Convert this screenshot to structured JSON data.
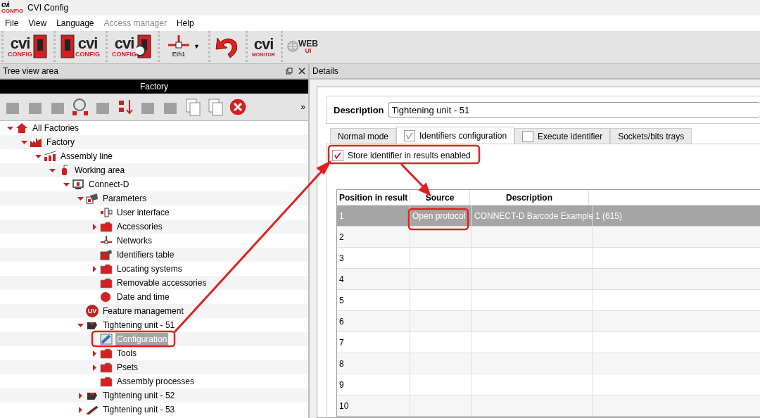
{
  "window": {
    "title": "CVI Config",
    "logo": "cvi",
    "logo_sub": "CONFIG"
  },
  "menu": [
    {
      "label": "File",
      "disabled": false
    },
    {
      "label": "View",
      "disabled": false
    },
    {
      "label": "Language",
      "disabled": false
    },
    {
      "label": "Access manager",
      "disabled": true
    },
    {
      "label": "Help",
      "disabled": false
    }
  ],
  "toolbar": [
    {
      "kind": "logo-arrow",
      "big": "cvi",
      "small": "CONFIG"
    },
    {
      "kind": "arrow-logo",
      "big": "cvi",
      "small": "CONFIG"
    },
    {
      "kind": "logo-search",
      "big": "cvi",
      "small": "CONFIG"
    },
    {
      "kind": "network",
      "small": "Eth1",
      "caret": "▼"
    },
    {
      "kind": "undo"
    },
    {
      "kind": "monitor",
      "big": "cvi",
      "small": "MONITOR"
    },
    {
      "kind": "web",
      "big": "WEB",
      "small": "UI"
    }
  ],
  "tree_panel": {
    "title": "Tree view area",
    "header": "Factory",
    "more": "»",
    "items": [
      {
        "label": "All Factories",
        "kind": "home",
        "expanded": true,
        "selected": false,
        "children": [
          {
            "label": "Factory",
            "kind": "factory",
            "expanded": true,
            "selected": false,
            "children": [
              {
                "label": "Assembly line",
                "kind": "line",
                "expanded": true,
                "selected": false,
                "children": [
                  {
                    "label": "Working area",
                    "kind": "area",
                    "expanded": true,
                    "selected": false,
                    "children": [
                      {
                        "label": "Connect-D",
                        "kind": "monitor",
                        "expanded": true,
                        "selected": false,
                        "children": [
                          {
                            "label": "Parameters",
                            "kind": "params",
                            "expanded": true,
                            "selected": false,
                            "children": [
                              {
                                "label": "User interface",
                                "kind": "ui",
                                "selected": false
                              },
                              {
                                "label": "Accessories",
                                "kind": "folder",
                                "expanded": false,
                                "selected": false
                              },
                              {
                                "label": "Networks",
                                "kind": "network",
                                "selected": false
                              },
                              {
                                "label": "Identifiers table",
                                "kind": "table",
                                "selected": false
                              },
                              {
                                "label": "Locating systems",
                                "kind": "folder",
                                "expanded": false,
                                "selected": false
                              },
                              {
                                "label": "Removable accessories",
                                "kind": "folder",
                                "selected": false
                              },
                              {
                                "label": "Date and time",
                                "kind": "clock",
                                "selected": false
                              }
                            ]
                          },
                          {
                            "label": "Feature management",
                            "kind": "badge",
                            "badge": "UV",
                            "selected": false
                          },
                          {
                            "label": "Tightening unit - 51",
                            "kind": "unit",
                            "expanded": true,
                            "selected": false,
                            "children": [
                              {
                                "label": "Configuration",
                                "kind": "config",
                                "selected": true
                              },
                              {
                                "label": "Tools",
                                "kind": "folder",
                                "expanded": false,
                                "selected": false
                              },
                              {
                                "label": "Psets",
                                "kind": "folder",
                                "expanded": false,
                                "selected": false
                              },
                              {
                                "label": "Assembly processes",
                                "kind": "folder",
                                "selected": false
                              }
                            ]
                          },
                          {
                            "label": "Tightening unit - 52",
                            "kind": "unit",
                            "expanded": false,
                            "selected": false
                          },
                          {
                            "label": "Tightening unit - 53",
                            "kind": "tool",
                            "expanded": false,
                            "selected": false
                          }
                        ]
                      }
                    ]
                  }
                ]
              }
            ]
          }
        ]
      }
    ]
  },
  "details": {
    "title": "Details",
    "description_label": "Description",
    "description": "Tightening unit - 51",
    "tabs": [
      {
        "label": "Normal mode",
        "kind": "plain",
        "selected": false
      },
      {
        "label": "Identifiers configuration",
        "kind": "checkbox",
        "checked": true,
        "selected": true
      },
      {
        "label": "Execute identifier",
        "kind": "checkbox",
        "checked": false,
        "selected": false
      },
      {
        "label": "Sockets/bits trays",
        "kind": "plain",
        "selected": false
      }
    ],
    "store_checkbox": {
      "label": "Store identifier in results enabled",
      "checked": true
    },
    "table": {
      "columns": [
        "Position in result",
        "Source",
        "Description"
      ],
      "rows": [
        {
          "cells": [
            "1",
            "Open protocol",
            "CONNECT-D Barcode Example",
            "1 (615)"
          ],
          "selected": true
        },
        {
          "cells": [
            "2"
          ],
          "selected": false
        },
        {
          "cells": [
            "3"
          ],
          "selected": false
        },
        {
          "cells": [
            "4"
          ],
          "selected": false
        },
        {
          "cells": [
            "5"
          ],
          "selected": false
        },
        {
          "cells": [
            "6"
          ],
          "selected": false
        },
        {
          "cells": [
            "7"
          ],
          "selected": false
        },
        {
          "cells": [
            "8"
          ],
          "selected": false
        },
        {
          "cells": [
            "9"
          ],
          "selected": false
        },
        {
          "cells": [
            "10"
          ],
          "selected": false
        }
      ]
    }
  }
}
